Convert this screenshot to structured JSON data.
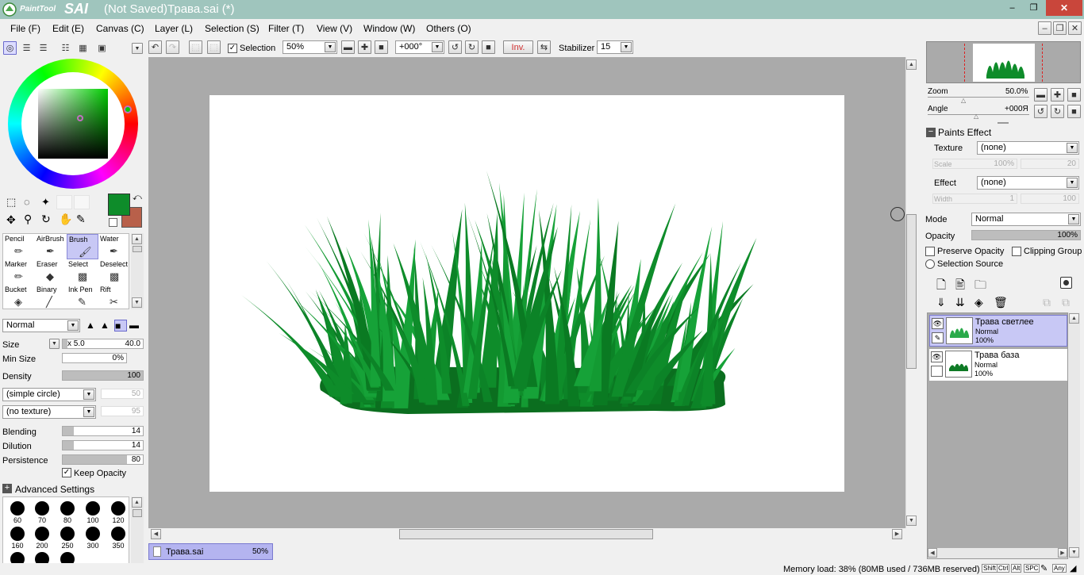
{
  "app": {
    "logo_small": "PaintTool",
    "logo_big": "SAI",
    "title": "(Not Saved)Трава.sai (*)"
  },
  "window_controls": {
    "minimize": "‒",
    "restore": "❐",
    "close": "✕"
  },
  "menu": {
    "items": [
      "File (F)",
      "Edit (E)",
      "Canvas (C)",
      "Layer (L)",
      "Selection (S)",
      "Filter (T)",
      "View (V)",
      "Window (W)",
      "Others (O)"
    ]
  },
  "toolbar": {
    "selection_label": "Selection",
    "zoom_value": "50%",
    "angle_value": "+000°",
    "inv_label": "Inv.",
    "stabilizer_label": "Stabilizer",
    "stabilizer_value": "15"
  },
  "colors": {
    "primary": "#0e8c2a",
    "secondary": "#b8604a",
    "title_bg": "#9fc5bd",
    "close_red": "#c9463b",
    "tab_bg": "#b4b4f0",
    "layer_sel": "#c8c8f5"
  },
  "tools": {
    "row1": [
      "Pencil",
      "AirBrush",
      "Brush",
      "Water"
    ],
    "row2": [
      "Marker",
      "Eraser",
      "Select",
      "Deselect"
    ],
    "row3": [
      "Bucket",
      "Binary",
      "Ink Pen",
      "Rift"
    ]
  },
  "brush": {
    "blend_mode": "Normal",
    "size_label": "Size",
    "size_mult": "x 5.0",
    "size_value": "40.0",
    "minsize_label": "Min Size",
    "minsize_value": "0%",
    "density_label": "Density",
    "density_value": "100",
    "shape": "(simple circle)",
    "shape_value": "50",
    "texture": "(no texture)",
    "texture_value": "95",
    "blending_label": "Blending",
    "blending_value": "14",
    "dilution_label": "Dilution",
    "dilution_value": "14",
    "persistence_label": "Persistence",
    "persistence_value": "80",
    "keep_opacity_label": "Keep Opacity",
    "advanced_label": "Advanced Settings"
  },
  "brush_sizes": [
    "60",
    "70",
    "80",
    "100",
    "120",
    "160",
    "200",
    "250",
    "300",
    "350"
  ],
  "document_tab": {
    "name": "Трава.sai",
    "zoom": "50%"
  },
  "navigator": {
    "zoom_label": "Zoom",
    "zoom_value": "50.0%",
    "angle_label": "Angle",
    "angle_value": "+000Я"
  },
  "paints_effect": {
    "header": "Paints Effect",
    "texture_label": "Texture",
    "texture_value": "(none)",
    "scale_label": "Scale",
    "scale_value": "100%",
    "scale_value2": "20",
    "effect_label": "Effect",
    "effect_value": "(none)",
    "width_label": "Width",
    "width_value": "1",
    "width_value2": "100"
  },
  "layer_props": {
    "mode_label": "Mode",
    "mode_value": "Normal",
    "opacity_label": "Opacity",
    "opacity_value": "100%",
    "preserve_label": "Preserve Opacity",
    "clipping_label": "Clipping Group",
    "selsource_label": "Selection Source"
  },
  "layers": [
    {
      "name": "Трава светлее",
      "mode": "Normal",
      "opacity": "100%"
    },
    {
      "name": "Трава база",
      "mode": "Normal",
      "opacity": "100%"
    }
  ],
  "status": {
    "memory": "Memory load: 38% (80MB used / 736MB reserved)",
    "keys": [
      "Shift",
      "Ctrl",
      "Alt",
      "SPC",
      "Any"
    ]
  }
}
